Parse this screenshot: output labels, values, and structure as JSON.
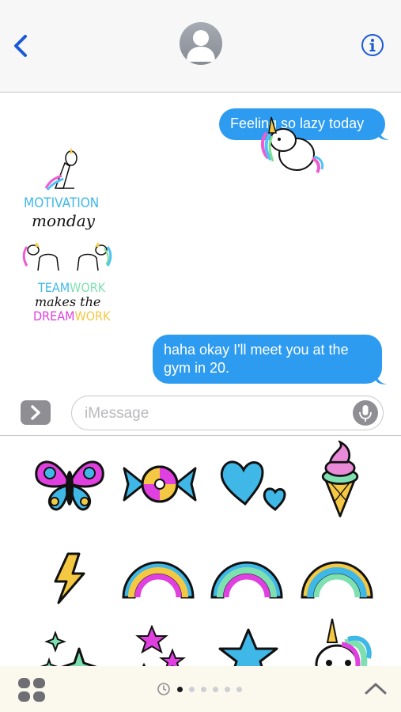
{
  "header": {
    "back_icon": "chevron-left-icon",
    "avatar_icon": "person-silhouette-icon",
    "info_icon": "info-circle-icon"
  },
  "messages": [
    {
      "side": "sent",
      "text": "Feeling so lazy today"
    },
    {
      "side": "sent",
      "text": "haha okay I'll meet you at the gym in 20."
    }
  ],
  "stickers_in_thread": [
    {
      "name": "lazy-unicorn-sticker"
    },
    {
      "name": "motivation-monday-sticker",
      "line1": "MOTIVATION",
      "line2": "monday"
    },
    {
      "name": "teamwork-sticker",
      "line1a": "TEAM",
      "line1b": "WORK",
      "line2": "makes the",
      "line3a": "DREAM",
      "line3b": "WORK"
    }
  ],
  "composer": {
    "placeholder": "iMessage",
    "apps_icon": "chevron-right-icon",
    "mic_icon": "microphone-icon"
  },
  "tray": {
    "stickers": [
      "butterfly",
      "candy",
      "hearts",
      "ice-cream",
      "lightning",
      "rainbow-pink",
      "rainbow-teal",
      "rainbow-yellow",
      "sparkles",
      "stars",
      "star-blue",
      "unicorn"
    ]
  },
  "bottom_bar": {
    "page_count": 6,
    "active_page": 0,
    "recents_icon": "clock-icon",
    "grid_icon": "app-grid-icon",
    "collapse_icon": "chevron-up-icon"
  },
  "colors": {
    "bubble_blue": "#2d9bf0",
    "ios_blue": "#1a5ad8"
  }
}
